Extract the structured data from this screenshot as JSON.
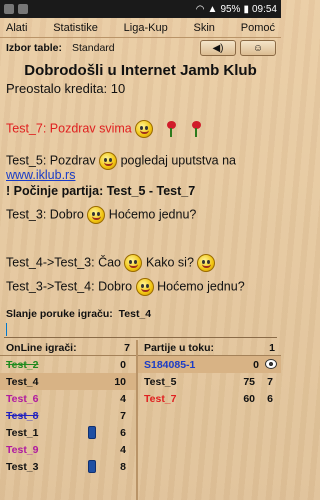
{
  "status": {
    "battery": "95%",
    "time": "09:54"
  },
  "menu": [
    "Alati",
    "Statistike",
    "Liga-Kup",
    "Skin",
    "Pomoć"
  ],
  "table": {
    "label": "Izbor table:",
    "value": "Standard"
  },
  "title": "Dobrodošli u Internet Jamb Klub",
  "credits": "Preostalo kredita:  10",
  "chat": {
    "m1": "Test_7: Pozdrav svima",
    "m2a": "Test_5: Pozdrav",
    "m2b": "pogledaj uputstva na",
    "m2link": "www.iklub.rs",
    "m3": "! Počinje partija: Test_5 - Test_7",
    "m4a": "Test_3: Dobro",
    "m4b": "Hoćemo jednu?",
    "m5a": "Test_4->Test_3: Čao",
    "m5b": "Kako si?",
    "m6a": "Test_3->Test_4: Dobro",
    "m6b": "Hoćemo jednu?"
  },
  "send": {
    "label": "Slanje poruke igraču:",
    "to": "Test_4"
  },
  "online": {
    "header": "OnLine igrači:",
    "count": "7",
    "players": [
      {
        "name": "Test_2",
        "value": "0",
        "color": "#1f8a1f"
      },
      {
        "name": "Test_4",
        "value": "10",
        "color": "#111111"
      },
      {
        "name": "Test_6",
        "value": "4",
        "color": "#b01aa0"
      },
      {
        "name": "Test_8",
        "value": "7",
        "color": "#2020c0"
      },
      {
        "name": "Test_1",
        "value": "6",
        "color": "#111111"
      },
      {
        "name": "Test_9",
        "value": "4",
        "color": "#b01aa0"
      },
      {
        "name": "Test_3",
        "value": "8",
        "color": "#111111"
      }
    ]
  },
  "games": {
    "header": "Partije u toku:",
    "count": "1",
    "rows": [
      {
        "name": "S184085-1",
        "v1": "",
        "v2": "0",
        "color": "#1a3cc7"
      },
      {
        "name": "Test_5",
        "v1": "75",
        "v2": "7",
        "color": "#111111"
      },
      {
        "name": "Test_7",
        "v1": "60",
        "v2": "6",
        "color": "#e02020"
      }
    ]
  }
}
